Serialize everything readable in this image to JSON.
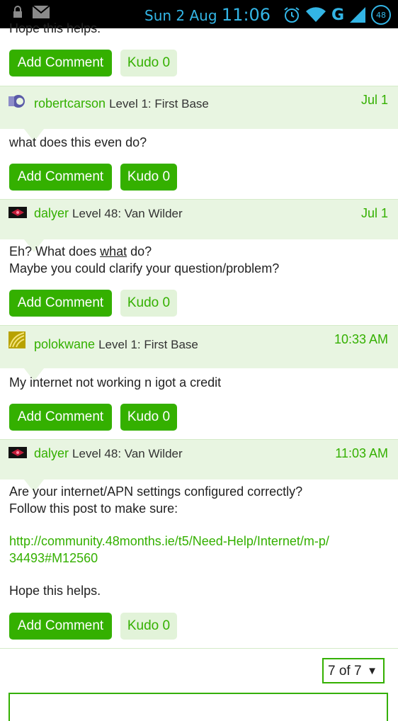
{
  "status_bar": {
    "date": "Sun 2 Aug",
    "time": "11:06",
    "network": "G",
    "battery": "48"
  },
  "prev_post": {
    "tail_text": "Hope this helps.",
    "add_comment": "Add Comment",
    "kudo": "Kudo 0"
  },
  "posts": [
    {
      "user": "robertcarson",
      "level": "Level 1: First Base",
      "date": "Jul 1",
      "lines": [
        "what does this even do?"
      ],
      "add_comment": "Add Comment",
      "kudo": "Kudo 0"
    },
    {
      "user": "dalyer",
      "level": "Level 48: Van Wilder",
      "date": "Jul 1",
      "line1_pre": "Eh? What does ",
      "line1_underlined": "what",
      "line1_post": " do?",
      "line2": "Maybe you could clarify your question/problem?",
      "add_comment": "Add Comment",
      "kudo": "Kudo 0"
    },
    {
      "user": "polokwane",
      "level": "Level 1: First Base",
      "date": "10:33 AM",
      "lines": [
        "My internet not working n igot a credit"
      ],
      "add_comment": "Add Comment",
      "kudo": "Kudo 0"
    },
    {
      "user": "dalyer",
      "level": "Level 48: Van Wilder",
      "date": "11:03 AM",
      "line1": "Are your internet/APN settings configured correctly?",
      "line2": "Follow this post to make sure:",
      "link_line1": "http://community.48months.ie/t5/Need-Help/Internet/m-p/",
      "link_line2": "34493#M12560",
      "closing": "Hope this helps.",
      "add_comment": "Add Comment",
      "kudo": "Kudo 0"
    }
  ],
  "pagination": {
    "label": "7 of 7",
    "caret": "▼"
  },
  "colors": {
    "accent": "#34b000",
    "header_bg": "#e8f5e1",
    "status_icon": "#33b5e5"
  }
}
